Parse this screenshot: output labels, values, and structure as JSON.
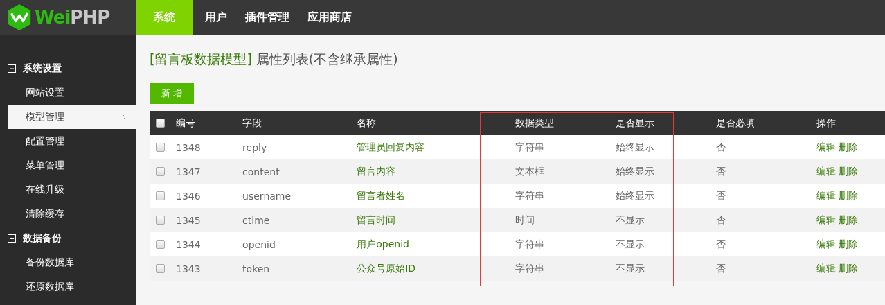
{
  "logo": {
    "part_1": "Wei",
    "part_2": "PHP"
  },
  "nav": [
    {
      "label": "系统",
      "selected": true
    },
    {
      "label": "用户",
      "selected": false
    },
    {
      "label": "插件管理",
      "selected": false
    },
    {
      "label": "应用商店",
      "selected": false
    }
  ],
  "sidebar": {
    "groups": [
      {
        "label": "系统设置",
        "expanded": true,
        "children": [
          {
            "label": "网站设置",
            "selected": false
          },
          {
            "label": "模型管理",
            "selected": true
          },
          {
            "label": "配置管理",
            "selected": false
          },
          {
            "label": "菜单管理",
            "selected": false
          },
          {
            "label": "在线升级",
            "selected": false
          },
          {
            "label": "清除缓存",
            "selected": false
          }
        ]
      },
      {
        "label": "数据备份",
        "expanded": true,
        "children": [
          {
            "label": "备份数据库",
            "selected": false
          },
          {
            "label": "还原数据库",
            "selected": false
          }
        ]
      }
    ]
  },
  "page_title": {
    "model": "[留言板数据模型]",
    "text": "属性列表(不含继承属性)"
  },
  "add_button": "新 增",
  "table": {
    "select_all": {
      "checked": false
    },
    "columns": [
      {
        "label": "编号",
        "highlighted": false
      },
      {
        "label": "字段",
        "highlighted": false
      },
      {
        "label": "名称",
        "highlighted": false
      },
      {
        "label": "数据类型",
        "highlighted": true
      },
      {
        "label": "是否显示",
        "highlighted": true
      },
      {
        "label": "是否必填",
        "highlighted": false
      },
      {
        "label": "操作",
        "highlighted": false
      }
    ],
    "rows": [
      {
        "checked": false,
        "id": "1348",
        "field": "reply",
        "name": "管理员回复内容",
        "type": "字符串",
        "display": "始终显示",
        "required": "否",
        "actions": [
          "编辑",
          "删除"
        ]
      },
      {
        "checked": false,
        "id": "1347",
        "field": "content",
        "name": "留言内容",
        "type": "文本框",
        "display": "始终显示",
        "required": "否",
        "actions": [
          "编辑",
          "删除"
        ]
      },
      {
        "checked": false,
        "id": "1346",
        "field": "username",
        "name": "留言者姓名",
        "type": "字符串",
        "display": "始终显示",
        "required": "否",
        "actions": [
          "编辑",
          "删除"
        ]
      },
      {
        "checked": false,
        "id": "1345",
        "field": "ctime",
        "name": "留言时间",
        "type": "时间",
        "display": "不显示",
        "required": "否",
        "actions": [
          "编辑",
          "删除"
        ]
      },
      {
        "checked": false,
        "id": "1344",
        "field": "openid",
        "name": "用户openid",
        "type": "字符串",
        "display": "不显示",
        "required": "否",
        "actions": [
          "编辑",
          "删除"
        ]
      },
      {
        "checked": false,
        "id": "1343",
        "field": "token",
        "name": "公众号原始ID",
        "type": "字符串",
        "display": "不显示",
        "required": "否",
        "actions": [
          "编辑",
          "删除"
        ]
      }
    ]
  }
}
